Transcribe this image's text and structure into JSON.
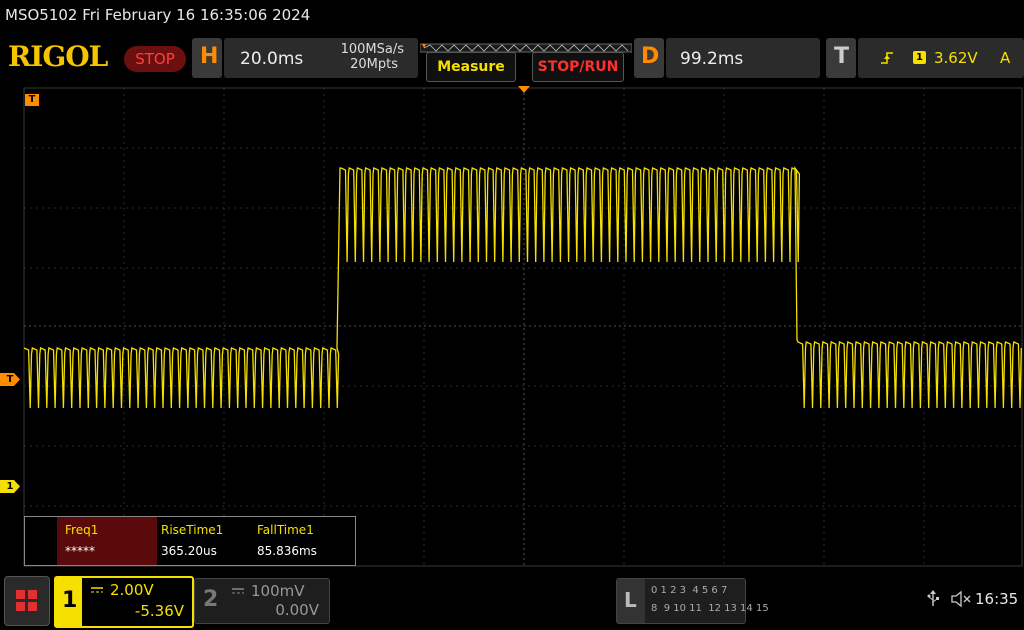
{
  "status_line": "MSO5102  Fri February 16 16:35:06 2024",
  "brand": "RIGOL",
  "run_state": "STOP",
  "horizontal": {
    "letter": "H",
    "timebase": "20.0ms",
    "sample_rate": "100MSa/s",
    "memory_depth": "20Mpts"
  },
  "buttons": {
    "measure": "Measure",
    "stop_run": "STOP/RUN"
  },
  "delay": {
    "letter": "D",
    "value": "99.2ms"
  },
  "trigger": {
    "letter": "T",
    "source": "1",
    "level": "3.62V",
    "mode": "A"
  },
  "markers": {
    "trigger_top": "T",
    "trigger_level": "T",
    "ch1_ground": "1"
  },
  "measurements": [
    {
      "label": "Freq1",
      "value": "*****"
    },
    {
      "label": "RiseTime1",
      "value": "365.20us"
    },
    {
      "label": "FallTime1",
      "value": "85.836ms"
    }
  ],
  "channel1": {
    "number": "1",
    "scale": "2.00V",
    "offset": "-5.36V"
  },
  "channel2": {
    "number": "2",
    "scale": "100mV",
    "offset": "0.00V"
  },
  "logic": {
    "letter": "L",
    "row1": "0 1 2 3  4 5 6 7",
    "row2": "8  9 10 11  12 13 14 15"
  },
  "clock": "16:35",
  "colors": {
    "ch1": "#f5e000",
    "accent": "#ff8c00",
    "stop": "#ff3030",
    "grid": "#3a3a3a"
  }
}
